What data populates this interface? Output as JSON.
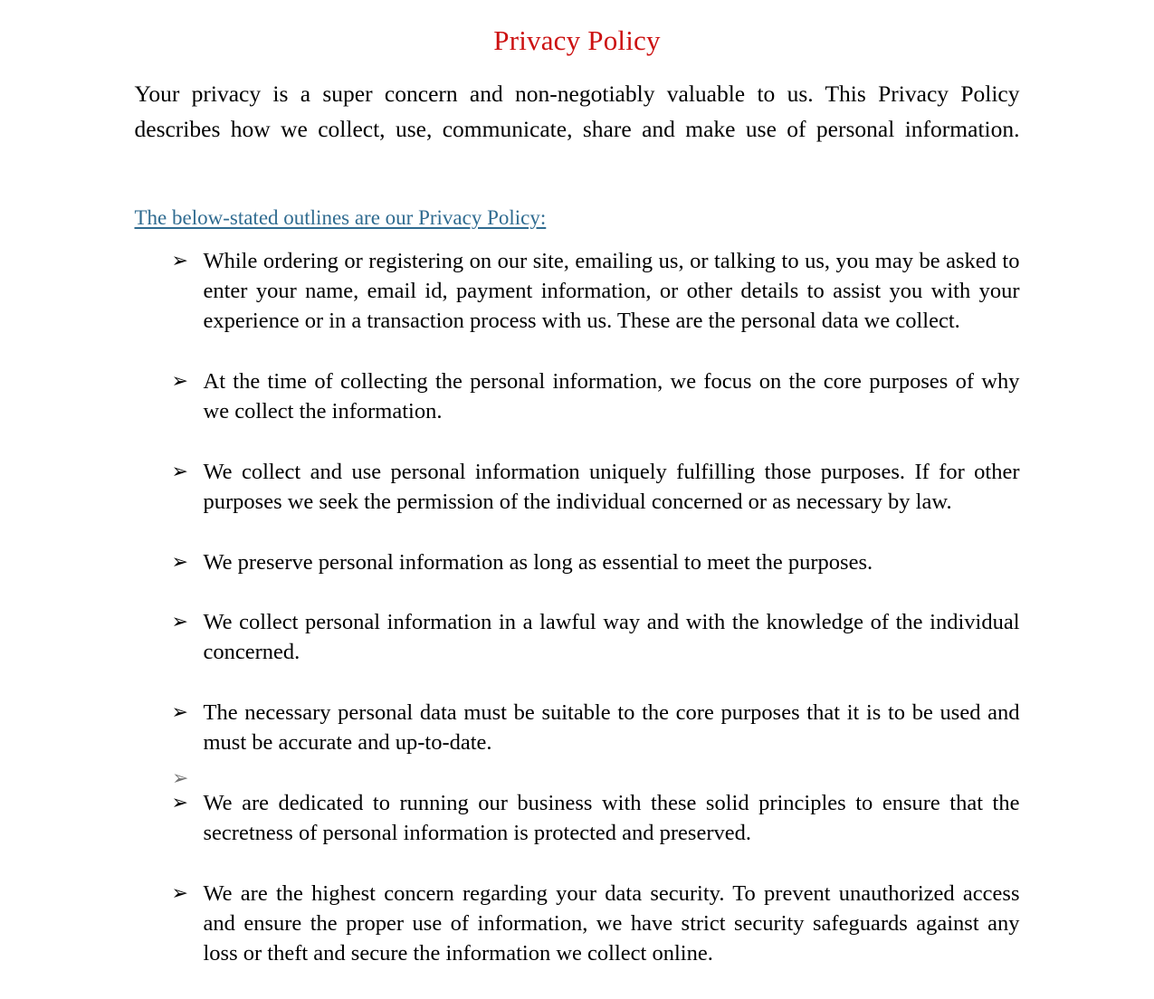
{
  "document": {
    "title": "Privacy Policy",
    "title_color": "#cc1111",
    "body_color": "#000000",
    "background_color": "#ffffff",
    "intro": "Your privacy is a super concern and non-negotiably valuable to us. This Privacy Policy describes how we collect, use, communicate, share and make use of personal information.",
    "section_heading": {
      "text": "The below-stated outlines are our Privacy Policy:",
      "color": "#2f6b90",
      "underlined": true
    },
    "bullet_marker": "➢",
    "bullets": [
      "While ordering or registering on our site, emailing us, or talking to us, you may be asked to enter your name, email id, payment information, or other details to assist you with your experience or in a transaction process with us. These are the personal data we collect.",
      "At the time of collecting the personal information, we focus on the core purposes of why we collect the information.",
      "We collect and use personal information uniquely fulfilling those purposes. If for other purposes we seek the permission of the individual concerned or as necessary by law.",
      "We preserve personal information as long as essential to meet the purposes.",
      "We collect personal information in a lawful way and with the knowledge of the individual concerned.",
      "The necessary personal data must be suitable to the core purposes that it is to be used and must be accurate and up-to-date.",
      "We are dedicated to running our business with these solid principles to ensure that the secretness of personal information is protected and preserved.",
      "We are the highest concern regarding your data security. To prevent unauthorized access and ensure the proper use of information, we have strict security safeguards against any loss or theft and secure the information we collect online."
    ]
  }
}
